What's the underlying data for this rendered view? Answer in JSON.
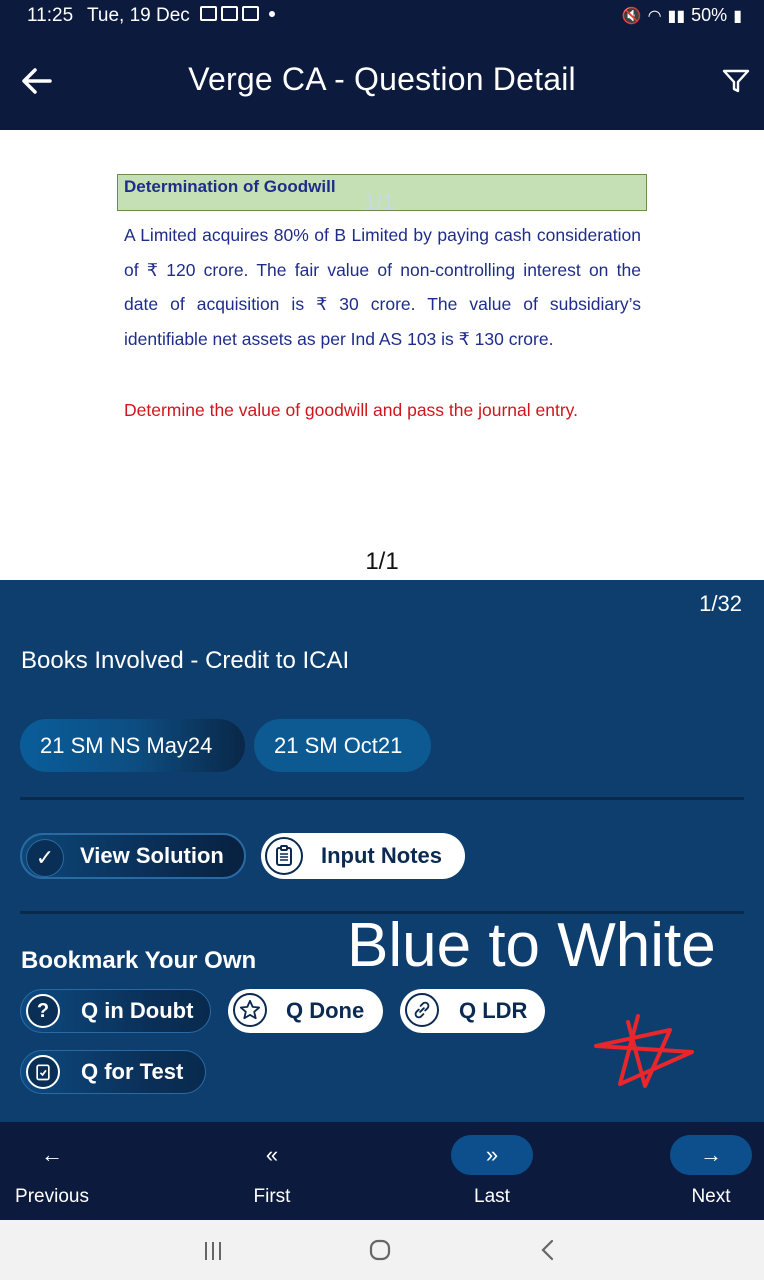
{
  "status_bar": {
    "time": "11:25",
    "date": "Tue, 19 Dec",
    "battery": "50%"
  },
  "header": {
    "title": "Verge CA - Question Detail"
  },
  "question": {
    "heading": "Determination of Goodwill",
    "watermark": "1/1",
    "body": "A Limited acquires 80% of B Limited by paying cash consideration of ₹ 120 crore. The fair value of non-controlling interest on the date of acquisition is ₹ 30 crore. The value of subsidiary’s identifiable net assets as per Ind AS 103 is ₹ 130 crore.",
    "instruction": "Determine the value of goodwill and pass the journal entry.",
    "page_indicator": "1/1"
  },
  "panel": {
    "counter": "1/32",
    "books_title": "Books Involved - Credit to ICAI",
    "books": [
      "21 SM NS May24",
      "21 SM Oct21"
    ],
    "view_solution_label": "View Solution",
    "input_notes_label": "Input Notes",
    "bookmark_title": "Bookmark Your Own",
    "overlay_text": "Blue to White",
    "bookmarks": {
      "doubt": "Q in Doubt",
      "done": "Q Done",
      "ldr": "Q LDR",
      "test": "Q for Test"
    }
  },
  "bottom_nav": {
    "previous": "Previous",
    "first": "First",
    "last": "Last",
    "next": "Next"
  },
  "colors": {
    "header_bg": "#0b1a3d",
    "panel_bg": "#0e3e6e",
    "question_heading_bg": "#c5e0b4",
    "question_text": "#1f2d8a",
    "instruction_text": "#d0161b",
    "scribble": "#e8262b"
  }
}
